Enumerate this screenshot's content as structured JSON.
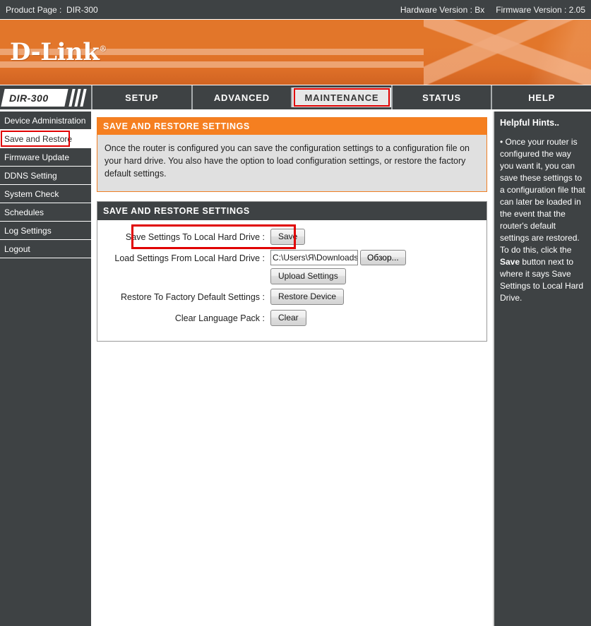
{
  "topbar": {
    "product_label": "Product Page :  DIR-300",
    "hardware_version": "Hardware Version : Bx",
    "firmware_version": "Firmware Version : 2.05"
  },
  "brand": {
    "name": "D-Link",
    "trademark": "®",
    "accent_color": "#e2762a"
  },
  "nav": {
    "model": "DIR-300",
    "tabs": [
      {
        "label": "SETUP",
        "active": false
      },
      {
        "label": "ADVANCED",
        "active": false
      },
      {
        "label": "MAINTENANCE",
        "active": true
      },
      {
        "label": "STATUS",
        "active": false
      },
      {
        "label": "HELP",
        "active": false
      }
    ]
  },
  "sidebar": {
    "items": [
      {
        "label": "Device Administration",
        "active": false
      },
      {
        "label": "Save and Restore",
        "active": true
      },
      {
        "label": "Firmware Update",
        "active": false
      },
      {
        "label": "DDNS Setting",
        "active": false
      },
      {
        "label": "System Check",
        "active": false
      },
      {
        "label": "Schedules",
        "active": false
      },
      {
        "label": "Log Settings",
        "active": false
      },
      {
        "label": "Logout",
        "active": false
      }
    ]
  },
  "description_panel": {
    "title": "SAVE AND RESTORE SETTINGS",
    "text": "Once the router is configured you can save the configuration settings to a configuration file on your hard drive. You also have the option to load configuration settings, or restore the factory default settings."
  },
  "form_panel": {
    "title": "SAVE AND RESTORE SETTINGS",
    "rows": {
      "save": {
        "label": "Save Settings To Local Hard Drive :",
        "button": "Save"
      },
      "load": {
        "label": "Load Settings From Local Hard Drive :",
        "file_value": "C:\\Users\\Я\\Downloads",
        "browse_button": "Обзор...",
        "upload_button": "Upload Settings"
      },
      "restore": {
        "label": "Restore To Factory Default Settings :",
        "button": "Restore Device"
      },
      "clear": {
        "label": "Clear Language Pack :",
        "button": "Clear"
      }
    }
  },
  "hints": {
    "title": "Helpful Hints..",
    "bullet": "•",
    "text_before_bold": " Once your router is configured the way you want it, you can save these settings to a configuration file that can later be loaded in the event that the router's default settings are restored. To do this, click the ",
    "bold_word": "Save",
    "text_after_bold": " button next to where it says Save Settings to Local Hard Drive."
  },
  "annotations": {
    "highlight_color": "#e00000"
  }
}
